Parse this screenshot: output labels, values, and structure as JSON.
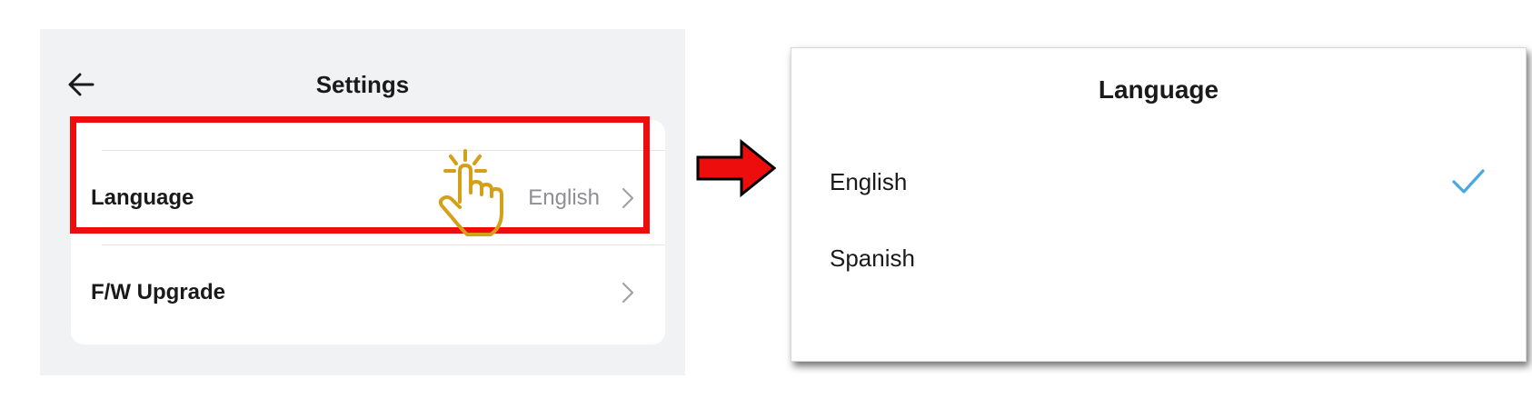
{
  "settings": {
    "title": "Settings",
    "back_icon": "back-arrow-icon",
    "rows": [
      {
        "label": "Language",
        "value": "English",
        "icon": "chevron-right-icon"
      },
      {
        "label": "F/W Upgrade",
        "value": "",
        "icon": "chevron-right-icon"
      }
    ]
  },
  "annotation": {
    "highlight_color": "#ee0d0d",
    "tap_icon": "tap-hand-icon",
    "tap_color": "#d4a017",
    "arrow_icon": "right-arrow-icon",
    "arrow_color": "#ee0d0d"
  },
  "language_dialog": {
    "title": "Language",
    "options": [
      {
        "label": "English",
        "selected": true
      },
      {
        "label": "Spanish",
        "selected": false
      }
    ],
    "check_icon": "checkmark-icon",
    "check_color": "#4aa8e0"
  }
}
